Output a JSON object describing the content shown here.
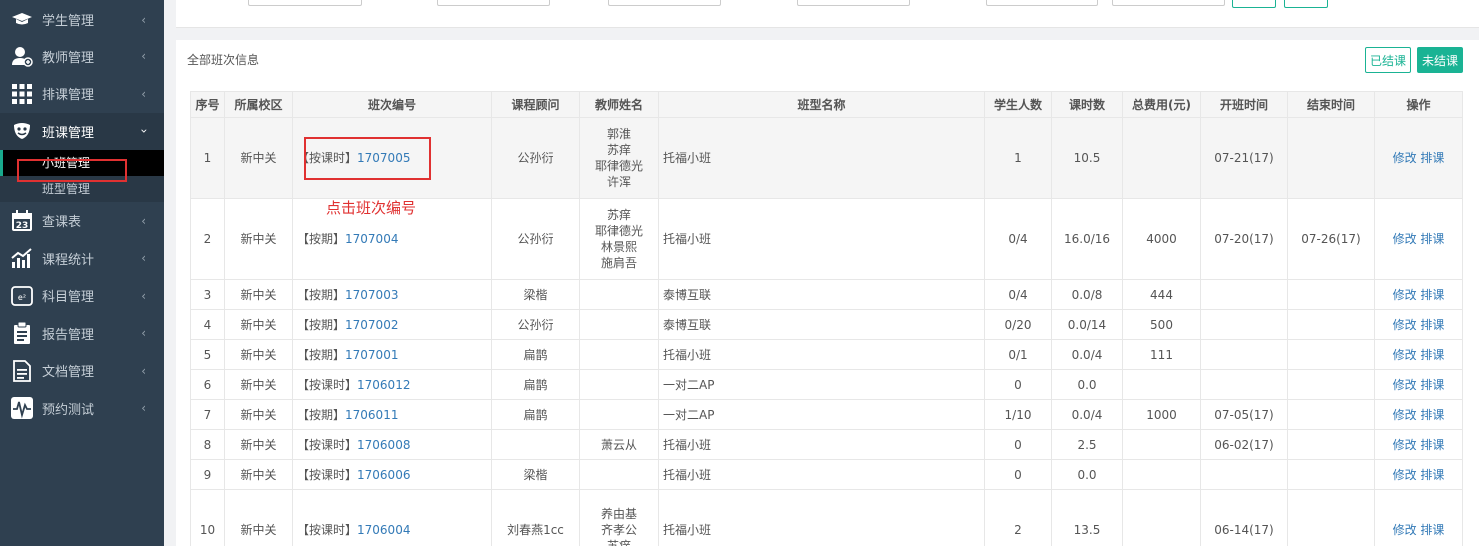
{
  "sidebar": {
    "items": [
      {
        "label": "学生管理",
        "icon": "graduation-cap-icon"
      },
      {
        "label": "教师管理",
        "icon": "user-plus-icon"
      },
      {
        "label": "排课管理",
        "icon": "grid-icon"
      },
      {
        "label": "班课管理",
        "icon": "mask-icon"
      },
      {
        "label": "查课表",
        "icon": "calendar-icon"
      },
      {
        "label": "课程统计",
        "icon": "chart-icon"
      },
      {
        "label": "科目管理",
        "icon": "subject-icon"
      },
      {
        "label": "报告管理",
        "icon": "clipboard-icon"
      },
      {
        "label": "文档管理",
        "icon": "document-icon"
      },
      {
        "label": "预约测试",
        "icon": "test-icon"
      }
    ],
    "submenu": [
      {
        "label": "小班管理"
      },
      {
        "label": "班型管理"
      }
    ],
    "calendar_day": "23"
  },
  "panel": {
    "title": "全部班次信息",
    "btn_finished": "已结课",
    "btn_unfinished": "未结课"
  },
  "table": {
    "headers": [
      "序号",
      "所属校区",
      "班次编号",
      "课程顾问",
      "教师姓名",
      "班型名称",
      "学生人数",
      "课时数",
      "总费用(元)",
      "开班时间",
      "结束时间",
      "操作"
    ],
    "rows": [
      {
        "no": "1",
        "campus": "新中关",
        "type": "【按课时】",
        "code": "1707005",
        "advisor": "公孙衍",
        "teachers": [
          "郭淮",
          "苏痒",
          "耶律德光",
          "许浑"
        ],
        "class_type": "托福小班",
        "students": "1",
        "hours": "10.5",
        "fee": "",
        "start": "07-21(17)",
        "end": "",
        "edit": "修改",
        "schedule": "排课"
      },
      {
        "no": "2",
        "campus": "新中关",
        "type": "【按期】",
        "code": "1707004",
        "advisor": "公孙衍",
        "teachers": [
          "苏痒",
          "耶律德光",
          "林景熙",
          "施肩吾"
        ],
        "class_type": "托福小班",
        "students": "0/4",
        "hours": "16.0/16",
        "fee": "4000",
        "start": "07-20(17)",
        "end": "07-26(17)",
        "edit": "修改",
        "schedule": "排课"
      },
      {
        "no": "3",
        "campus": "新中关",
        "type": "【按期】",
        "code": "1707003",
        "advisor": "梁楷",
        "teachers": [],
        "class_type": "泰博互联",
        "students": "0/4",
        "hours": "0.0/8",
        "fee": "444",
        "start": "",
        "end": "",
        "edit": "修改",
        "schedule": "排课"
      },
      {
        "no": "4",
        "campus": "新中关",
        "type": "【按期】",
        "code": "1707002",
        "advisor": "公孙衍",
        "teachers": [],
        "class_type": "泰博互联",
        "students": "0/20",
        "hours": "0.0/14",
        "fee": "500",
        "start": "",
        "end": "",
        "edit": "修改",
        "schedule": "排课"
      },
      {
        "no": "5",
        "campus": "新中关",
        "type": "【按期】",
        "code": "1707001",
        "advisor": "扁鹊",
        "teachers": [],
        "class_type": "托福小班",
        "students": "0/1",
        "hours": "0.0/4",
        "fee": "111",
        "start": "",
        "end": "",
        "edit": "修改",
        "schedule": "排课"
      },
      {
        "no": "6",
        "campus": "新中关",
        "type": "【按课时】",
        "code": "1706012",
        "advisor": "扁鹊",
        "teachers": [],
        "class_type": "一对二AP",
        "students": "0",
        "hours": "0.0",
        "fee": "",
        "start": "",
        "end": "",
        "edit": "修改",
        "schedule": "排课"
      },
      {
        "no": "7",
        "campus": "新中关",
        "type": "【按期】",
        "code": "1706011",
        "advisor": "扁鹊",
        "teachers": [],
        "class_type": "一对二AP",
        "students": "1/10",
        "hours": "0.0/4",
        "fee": "1000",
        "start": "07-05(17)",
        "end": "",
        "edit": "修改",
        "schedule": "排课"
      },
      {
        "no": "8",
        "campus": "新中关",
        "type": "【按课时】",
        "code": "1706008",
        "advisor": "",
        "teachers": [
          "萧云从"
        ],
        "class_type": "托福小班",
        "students": "0",
        "hours": "2.5",
        "fee": "",
        "start": "06-02(17)",
        "end": "",
        "edit": "修改",
        "schedule": "排课"
      },
      {
        "no": "9",
        "campus": "新中关",
        "type": "【按课时】",
        "code": "1706006",
        "advisor": "梁楷",
        "teachers": [],
        "class_type": "托福小班",
        "students": "0",
        "hours": "0.0",
        "fee": "",
        "start": "",
        "end": "",
        "edit": "修改",
        "schedule": "排课"
      },
      {
        "no": "10",
        "campus": "新中关",
        "type": "【按课时】",
        "code": "1706004",
        "advisor": "刘春燕1cc",
        "teachers": [
          "养由基",
          "齐孝公",
          "苏痒"
        ],
        "class_type": "托福小班",
        "students": "2",
        "hours": "13.5",
        "fee": "",
        "start": "06-14(17)",
        "end": "",
        "edit": "修改",
        "schedule": "排课"
      }
    ]
  },
  "annotation": {
    "text": "点击班次编号"
  }
}
